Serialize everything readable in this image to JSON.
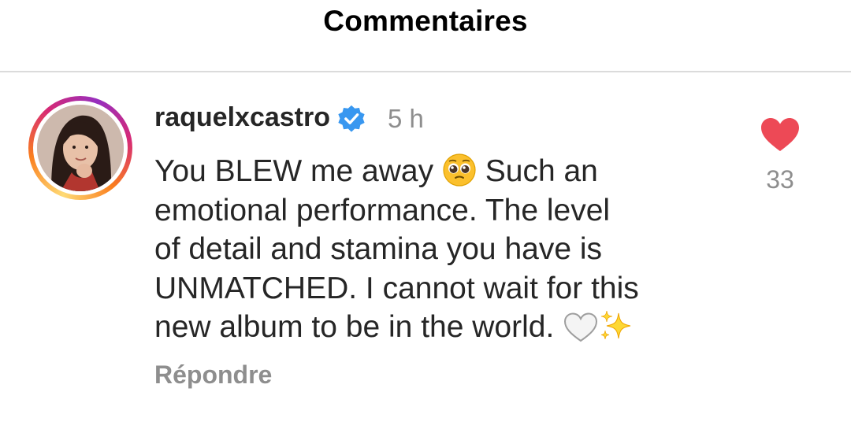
{
  "header": {
    "title": "Commentaires"
  },
  "comment": {
    "username": "raquelxcastro",
    "verified": true,
    "time": "5 h",
    "lines": [
      "You BLEW me away ",
      " Such an",
      "emotional performance. The level",
      "of detail and stamina you have is",
      "UNMATCHED. I cannot wait for this",
      "new album to be in the world. "
    ],
    "emojis": [
      "pleading-face-icon",
      "white-heart-icon",
      "sparkles-icon"
    ],
    "reply_label": "Répondre",
    "like_count": "33",
    "liked": true
  },
  "colors": {
    "heart": "#ed4956",
    "verified": "#3897f0",
    "muted_text": "#8e8e8e",
    "divider": "#dbdbdb"
  }
}
